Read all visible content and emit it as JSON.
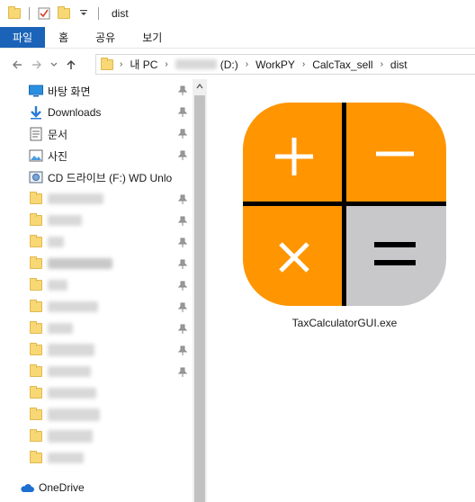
{
  "window": {
    "title": "dist"
  },
  "ribbon": {
    "tabs": [
      "파일",
      "홈",
      "공유",
      "보기"
    ]
  },
  "address": {
    "crumbs": [
      "내 PC",
      "(D:)",
      "WorkPY",
      "CalcTax_sell",
      "dist"
    ]
  },
  "nav": {
    "items": [
      {
        "label": "바탕 화면",
        "icon": "desktop-icon"
      },
      {
        "label": "Downloads",
        "icon": "download-icon"
      },
      {
        "label": "문서",
        "icon": "documents-icon"
      },
      {
        "label": "사진",
        "icon": "pictures-icon"
      },
      {
        "label": "CD 드라이브 (F:) WD Unlo",
        "icon": "cd-drive-icon"
      }
    ],
    "onedrive": "OneDrive"
  },
  "content": {
    "file": {
      "name": "TaxCalculatorGUI.exe",
      "icon": "calculator-app-icon"
    }
  },
  "colors": {
    "accent": "#1a63b8",
    "calc_orange": "#ff9500",
    "calc_gray": "#c8c8cb",
    "folder": "#f8d775"
  }
}
